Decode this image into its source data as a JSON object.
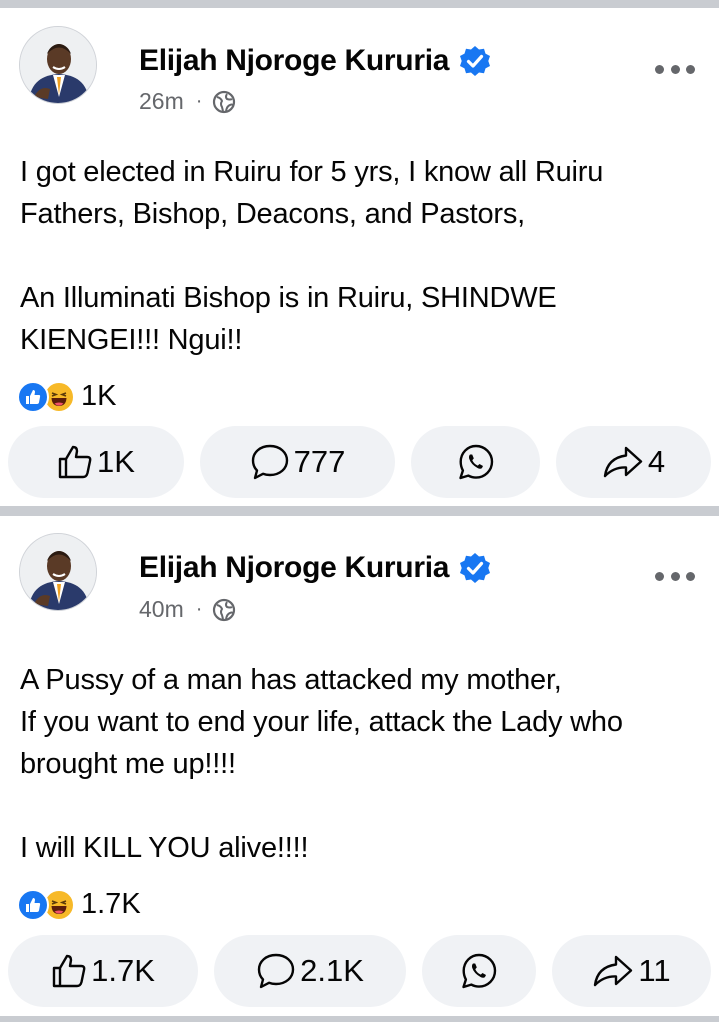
{
  "posts": [
    {
      "author": "Elijah Njoroge Kururia",
      "time": "26m",
      "separator": "·",
      "text": "I got elected in Ruiru for 5 yrs, I know all Ruiru Fathers, Bishop, Deacons, and Pastors,\n\nAn Illuminati Bishop is in Ruiru, SHINDWE KIENGEI!!! Ngui!!",
      "reaction_count": "1K",
      "like_count": "1K",
      "comment_count": "777",
      "share_count": "4"
    },
    {
      "author": "Elijah Njoroge Kururia",
      "time": "40m",
      "separator": "·",
      "text": "A Pussy of a man has attacked my mother,\nIf you want to end your life, attack the Lady who brought me up!!!!\n\nI will KILL YOU alive!!!!",
      "reaction_count": "1.7K",
      "like_count": "1.7K",
      "comment_count": "2.1K",
      "share_count": "11"
    }
  ],
  "icons": {
    "verified": "verified-badge-icon",
    "privacy": "globe-icon",
    "more": "more-options-icon",
    "like_reaction": "like-reaction-icon",
    "haha_reaction": "haha-reaction-icon",
    "like": "thumbs-up-icon",
    "comment": "comment-icon",
    "whatsapp": "whatsapp-icon",
    "share": "share-icon"
  },
  "colors": {
    "accent": "#1877f2",
    "haha": "#f7b928",
    "secondary_text": "#65676b",
    "button_bg": "#f0f2f5",
    "divider": "#c9ccd1"
  }
}
